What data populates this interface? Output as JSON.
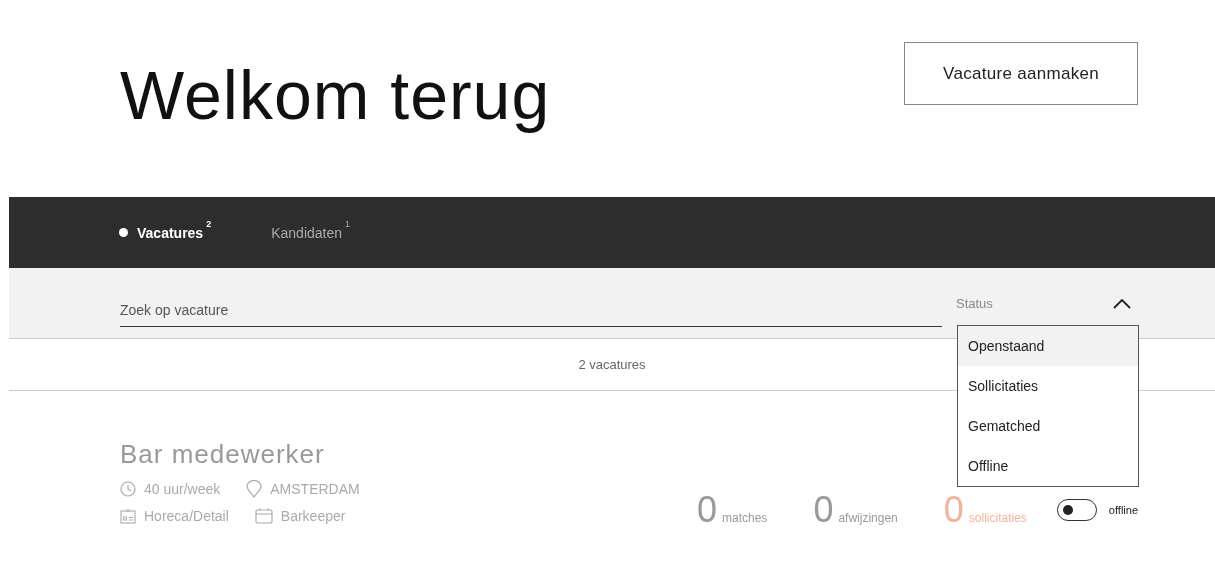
{
  "header": {
    "title": "Welkom terug",
    "create_button": "Vacature aanmaken"
  },
  "tabs": [
    {
      "label": "Vacatures",
      "count": "2",
      "selected": true
    },
    {
      "label": "Kandidaten",
      "count": "1",
      "selected": false
    }
  ],
  "search": {
    "placeholder": "Zoek op vacature"
  },
  "status_filter": {
    "label": "Status",
    "expanded": true,
    "options": [
      {
        "label": "Openstaand",
        "selected": true
      },
      {
        "label": "Sollicitaties",
        "selected": false
      },
      {
        "label": "Gematched",
        "selected": false
      },
      {
        "label": "Offline",
        "selected": false
      }
    ]
  },
  "result_count": "2 vacatures",
  "jobs": [
    {
      "title": "Bar medewerker",
      "hours": "40 uur/week",
      "location": "AMSTERDAM",
      "sector": "Horeca/Detail",
      "function": "Barkeeper",
      "stats": [
        {
          "value": "0",
          "label": "matches",
          "highlight": false
        },
        {
          "value": "0",
          "label": "afwijzingen",
          "highlight": false
        },
        {
          "value": "0",
          "label": "sollicitaties",
          "highlight": true
        }
      ],
      "online": false,
      "toggle_label": "offline"
    }
  ]
}
